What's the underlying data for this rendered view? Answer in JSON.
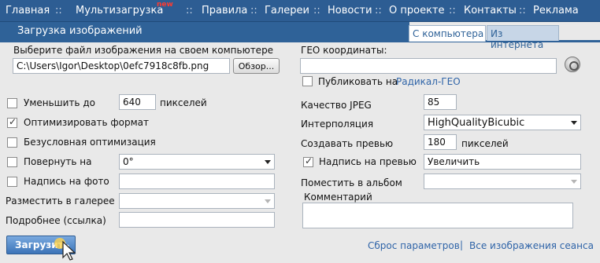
{
  "nav": {
    "items": [
      "Главная",
      "Мультизагрузка",
      "Правила",
      "Галереи",
      "Новости",
      "О проекте",
      "Контакты",
      "Реклама"
    ],
    "new_badge": "new",
    "separator": "::"
  },
  "header": {
    "title": "Загрузка изображений",
    "tabs": [
      "С компьютера",
      "Из интернета"
    ]
  },
  "file": {
    "label": "Выберите файл изображения на своем компьютере",
    "value": "C:\\Users\\Igor\\Desktop\\0efc7918c8fb.png",
    "browse_label": "Обзор..."
  },
  "geo": {
    "label": "ГЕО координаты:",
    "value": "",
    "publish_label": "Публиковать на",
    "publish_link": "Радикал-ГЕО",
    "publish_checked": false
  },
  "left_options": {
    "reduce": {
      "label": "Уменьшить до",
      "value": "640",
      "unit": "пикселей",
      "checked": false
    },
    "optimize": {
      "label": "Оптимизировать формат",
      "checked": true
    },
    "force_optimize": {
      "label": "Безусловная оптимизация",
      "checked": false
    },
    "rotate": {
      "label": "Повернуть на",
      "value": "0°",
      "checked": false
    },
    "caption": {
      "label": "Надпись на фото",
      "value": "",
      "checked": false
    },
    "gallery": {
      "label": "Разместить в галерее",
      "value": ""
    },
    "details": {
      "label": "Подробнее (ссылка)",
      "value": ""
    }
  },
  "right_options": {
    "jpeg": {
      "label": "Качество JPEG",
      "value": "85"
    },
    "interpolation": {
      "label": "Интерполяция",
      "value": "HighQualityBicubic"
    },
    "preview": {
      "label": "Создавать превью",
      "value": "180",
      "unit": "пикселей"
    },
    "preview_caption": {
      "label": "Надпись на превью",
      "value": "Увеличить",
      "checked": true
    },
    "album": {
      "label": "Поместить в альбом",
      "value": ""
    },
    "comment": {
      "label": "Комментарий",
      "value": ""
    }
  },
  "footer": {
    "upload_label": "Загрузить",
    "reset_link": "Сброс параметров",
    "divider": "|",
    "all_images_link": "Все изображения сеанса"
  },
  "colors": {
    "nav_bg": "#2d5d93",
    "title_bg": "#2f6298",
    "link": "#2f64a8",
    "new_badge": "#ff3b30"
  }
}
